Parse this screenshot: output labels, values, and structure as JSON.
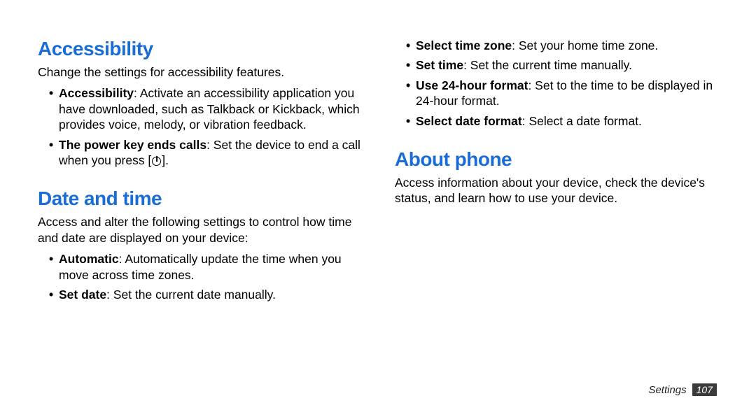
{
  "leftColumn": {
    "accessibility": {
      "heading": "Accessibility",
      "intro": "Change the settings for accessibility features.",
      "items": [
        {
          "label": "Accessibility",
          "text": ": Activate an accessibility application you have downloaded, such as Talkback or Kickback, which provides voice, melody, or vibration feedback."
        },
        {
          "label": "The power key ends calls",
          "text_before": ": Set the device to end a call when you press [",
          "text_after": "]."
        }
      ]
    },
    "dateTime": {
      "heading": "Date and time",
      "intro": "Access and alter the following settings to control how time and date are displayed on your device:",
      "items": [
        {
          "label": "Automatic",
          "text": ": Automatically update the time when you move across time zones."
        },
        {
          "label": "Set date",
          "text": ": Set the current date manually."
        }
      ]
    }
  },
  "rightColumn": {
    "dateTimeCont": {
      "items": [
        {
          "label": "Select time zone",
          "text": ": Set your home time zone."
        },
        {
          "label": "Set time",
          "text": ": Set the current time manually."
        },
        {
          "label": "Use 24-hour format",
          "text": ": Set to the time to be displayed in 24-hour format."
        },
        {
          "label": "Select date format",
          "text": ": Select a date format."
        }
      ]
    },
    "aboutPhone": {
      "heading": "About phone",
      "intro": "Access information about your device, check the device's status, and learn how to use your device."
    }
  },
  "footer": {
    "section": "Settings",
    "page": "107"
  }
}
